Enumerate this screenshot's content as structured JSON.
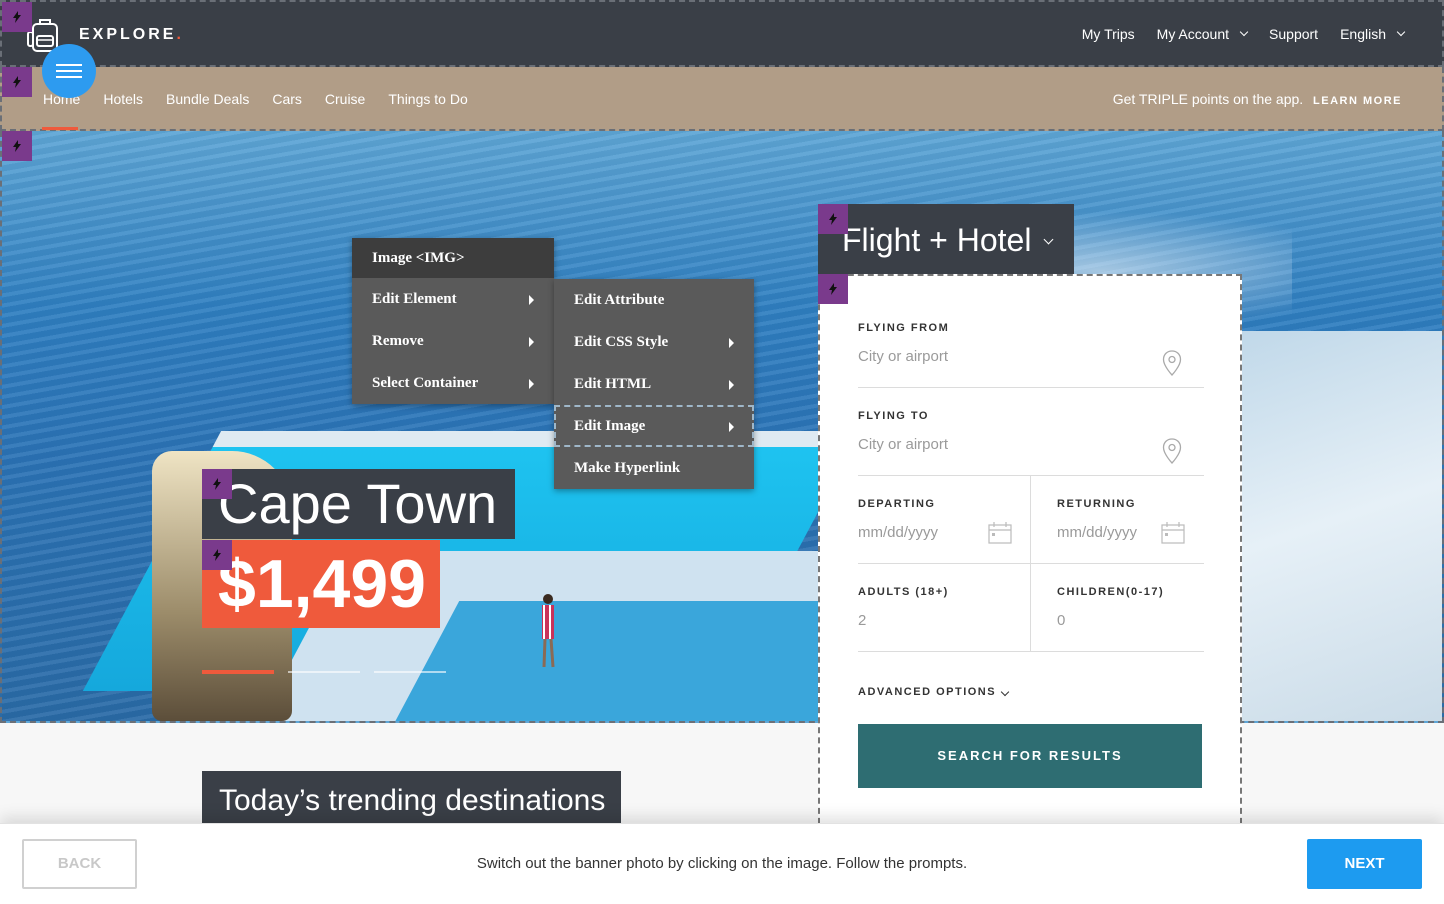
{
  "header": {
    "brand": "EXPLORE",
    "brand_dot": ".",
    "links": [
      "My Trips",
      "My Account",
      "Support",
      "English"
    ]
  },
  "nav": {
    "items": [
      "Home",
      "Hotels",
      "Bundle Deals",
      "Cars",
      "Cruise",
      "Things to Do"
    ],
    "promo_text": "Get TRIPLE points on the app.",
    "promo_link": "LEARN MORE"
  },
  "hero": {
    "city": "Cape Town",
    "price": "$1,499",
    "slide_count": 3,
    "active_slide": 1
  },
  "context_menu": {
    "header": "Image <IMG>",
    "items": [
      "Edit Element",
      "Remove",
      "Select Container"
    ],
    "submenu": [
      "Edit Attribute",
      "Edit CSS Style",
      "Edit HTML",
      "Edit Image",
      "Make Hyperlink"
    ]
  },
  "booking": {
    "tab_title": "Flight + Hotel",
    "flying_from_label": "FLYING FROM",
    "flying_from_placeholder": "City or airport",
    "flying_to_label": "FLYING TO",
    "flying_to_placeholder": "City or airport",
    "departing_label": "DEPARTING",
    "departing_placeholder": "mm/dd/yyyy",
    "returning_label": "RETURNING",
    "returning_placeholder": "mm/dd/yyyy",
    "adults_label": "ADULTS (18+)",
    "adults_value": "2",
    "children_label": "CHILDREN(0-17)",
    "children_value": "0",
    "advanced_label": "ADVANCED OPTIONS",
    "search_label": "SEARCH FOR RESULTS"
  },
  "trending": {
    "title": "Today’s trending destinations"
  },
  "footer": {
    "back_label": "BACK",
    "instruction": "Switch out the banner photo by clicking on the image. Follow the prompts.",
    "next_label": "NEXT"
  },
  "colors": {
    "dark": "#3a3f47",
    "accent": "#ef5a3c",
    "nav_tan": "#b19d87",
    "primary_blue": "#1d9bf0",
    "teal_button": "#2e6d72",
    "badge_purple": "#7a3a8c"
  },
  "icons": {
    "logo": "backpack-icon",
    "menu": "hamburger-icon",
    "edit_badge": "lightning-icon",
    "location": "map-pin-icon",
    "calendar": "calendar-icon"
  }
}
